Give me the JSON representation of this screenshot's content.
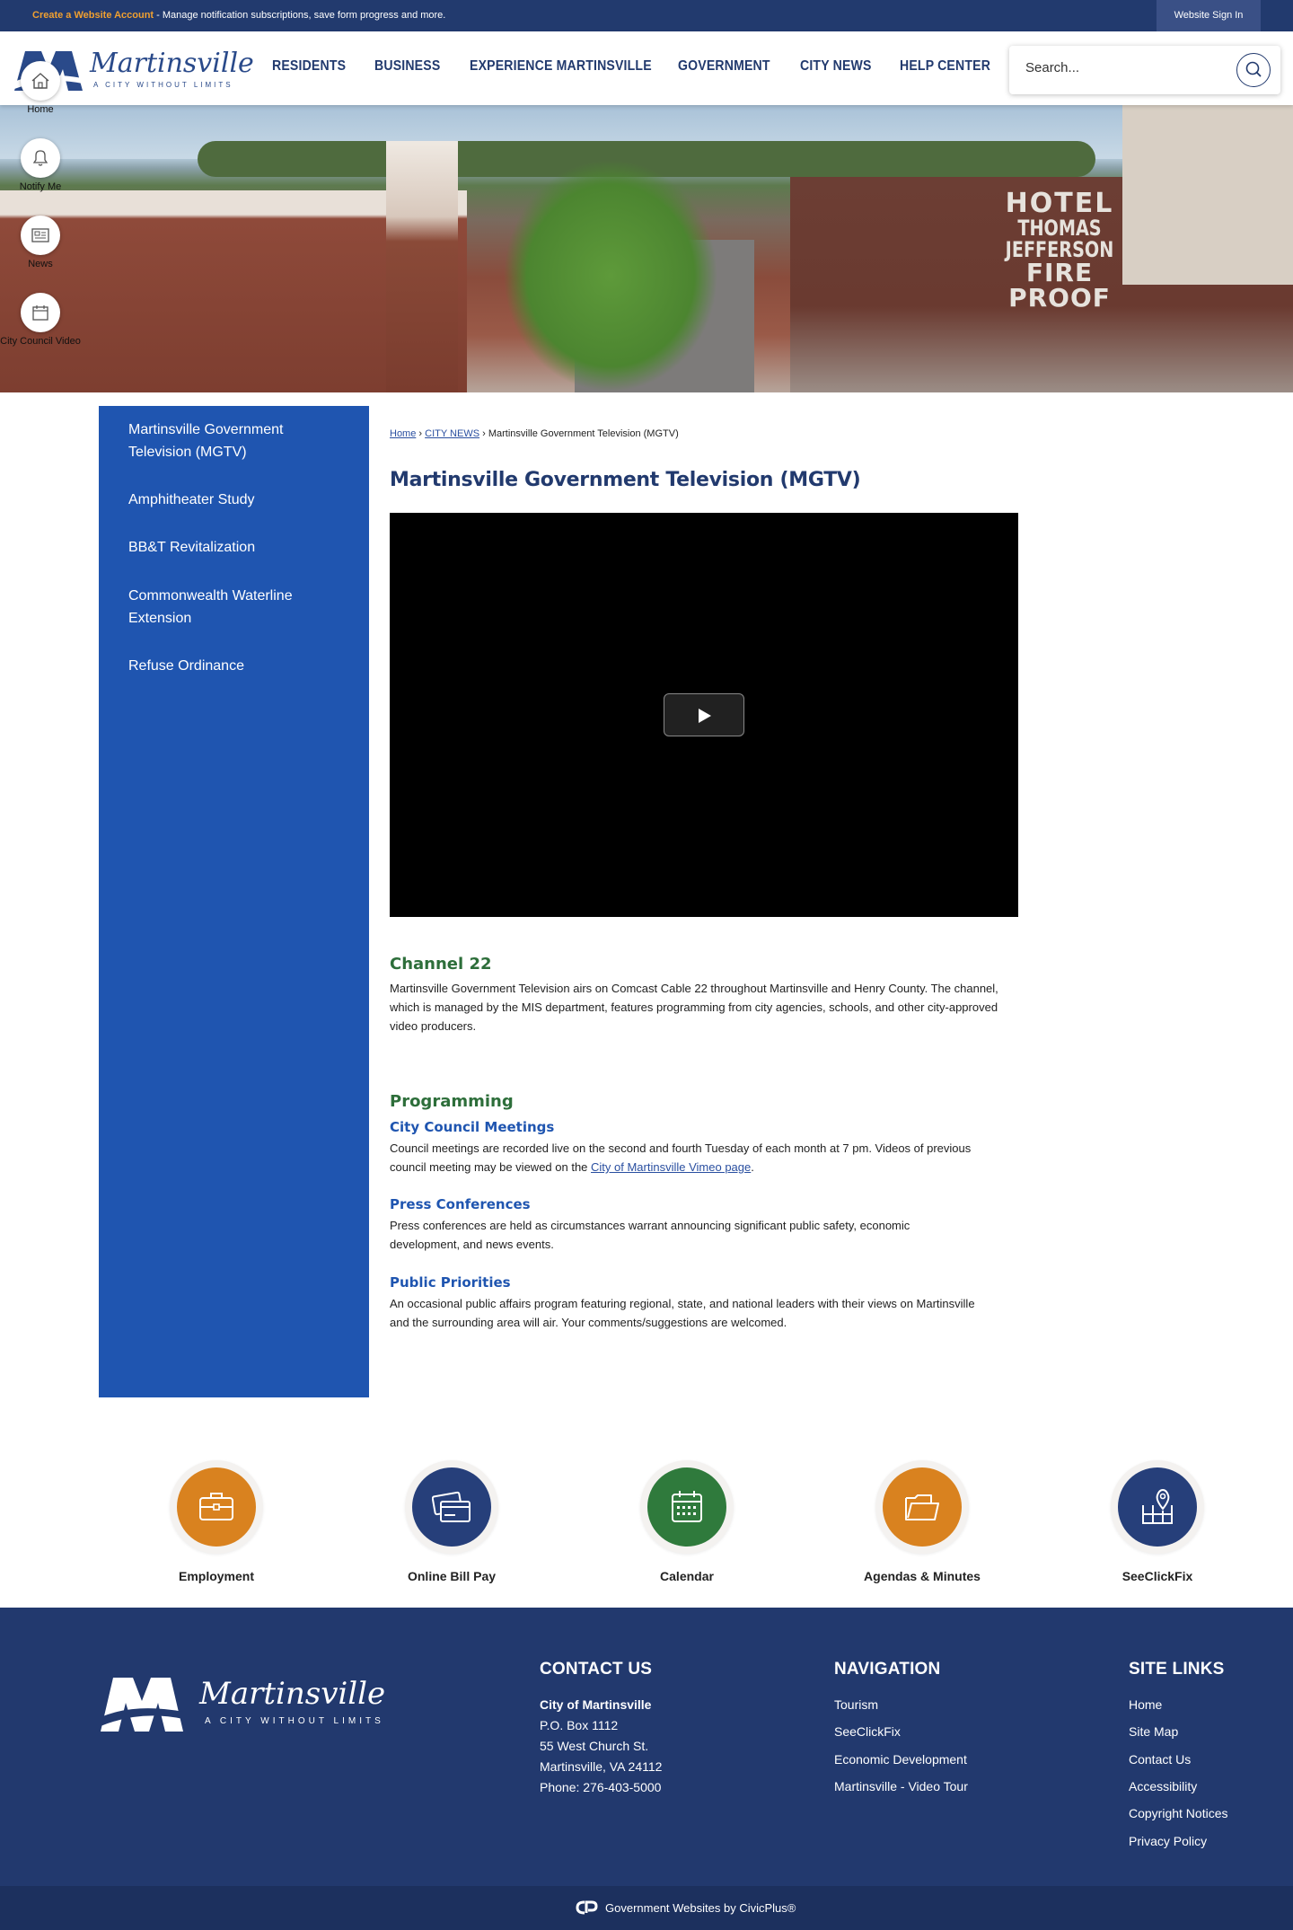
{
  "topbar": {
    "create_account": "Create a Website Account",
    "notice": " - Manage notification subscriptions, save form progress and more.",
    "sign_in": "Website Sign In"
  },
  "header": {
    "logo_text": "Martinsville",
    "logo_tagline": "A CITY WITHOUT LIMITS",
    "nav": [
      "RESIDENTS",
      "BUSINESS",
      "EXPERIENCE MARTINSVILLE",
      "GOVERNMENT",
      "CITY NEWS",
      "HELP CENTER"
    ],
    "search_placeholder": "Search..."
  },
  "hero": {
    "sign_line1": "HOTEL",
    "sign_line2": "THOMAS JEFFERSON",
    "sign_line3": "FIRE PROOF"
  },
  "rail": [
    {
      "label": "Home",
      "icon": "home-icon"
    },
    {
      "label": "Notify Me",
      "icon": "bell-icon"
    },
    {
      "label": "News",
      "icon": "newspaper-icon"
    },
    {
      "label": "City Council Video",
      "icon": "calendar-icon"
    }
  ],
  "sidebar": {
    "items": [
      "Martinsville Government Television (MGTV)",
      "Amphitheater Study",
      "BB&T Revitalization",
      "Commonwealth Waterline Extension",
      "Refuse Ordinance"
    ]
  },
  "breadcrumb": {
    "home": "Home",
    "sep1": " › ",
    "news": "CITY NEWS",
    "sep2": " › ",
    "current": "Martinsville Government Television (MGTV)"
  },
  "main": {
    "title": "Martinsville Government Television (MGTV)",
    "channel_heading": "Channel 22",
    "channel_text": "Martinsville Government Television airs on Comcast Cable 22 throughout Martinsville and Henry County. The channel, which is managed by the MIS department, features programming from city agencies, schools, and other city-approved video producers.",
    "programming_heading": "Programming",
    "council_heading": "City Council Meetings",
    "council_text": "Council meetings are recorded live on the second and fourth Tuesday of each month at 7 pm. Videos of previous council meeting may be viewed on the ",
    "council_link": "City of Martinsville Vimeo page",
    "council_end": ".",
    "press_heading": "Press Conferences",
    "press_text": "Press conferences are held as circumstances warrant announcing significant public safety, economic development, and news events.",
    "priorities_heading": "Public Priorities",
    "priorities_text": "An occasional public affairs program featuring regional, state, and national leaders with their views on Martinsville and the surrounding area will air. Your comments/suggestions are welcomed."
  },
  "quicklinks": [
    {
      "label": "Employment",
      "icon": "briefcase-icon",
      "color": "#d9821f"
    },
    {
      "label": "Online Bill Pay",
      "icon": "credit-card-icon",
      "color": "#263f7a"
    },
    {
      "label": "Calendar",
      "icon": "calendar-icon",
      "color": "#2f7a3c"
    },
    {
      "label": "Agendas & Minutes",
      "icon": "folder-icon",
      "color": "#d9821f"
    },
    {
      "label": "SeeClickFix",
      "icon": "map-pin-icon",
      "color": "#263f7a"
    }
  ],
  "footer": {
    "logo_text": "Martinsville",
    "logo_tagline": "A CITY WITHOUT LIMITS",
    "contact": {
      "heading": "CONTACT US",
      "name": "City of Martinsville",
      "po": "P.O. Box 1112",
      "street": "55 West Church St.",
      "city": "Martinsville, VA 24112",
      "phone": "Phone: 276-403-5000"
    },
    "navigation": {
      "heading": "NAVIGATION",
      "links": [
        "Tourism",
        "SeeClickFix",
        "Economic Development",
        "Martinsville - Video Tour"
      ]
    },
    "site_links": {
      "heading": "SITE LINKS",
      "links": [
        "Home",
        "Site Map",
        "Contact Us",
        "Accessibility",
        "Copyright Notices",
        "Privacy Policy"
      ]
    },
    "credit": "Government Websites by CivicPlus®"
  },
  "colors": {
    "navy": "#223a6e",
    "sidebar_blue": "#1f55b0",
    "green_heading": "#2d6e3a",
    "orange": "#d9821f"
  }
}
